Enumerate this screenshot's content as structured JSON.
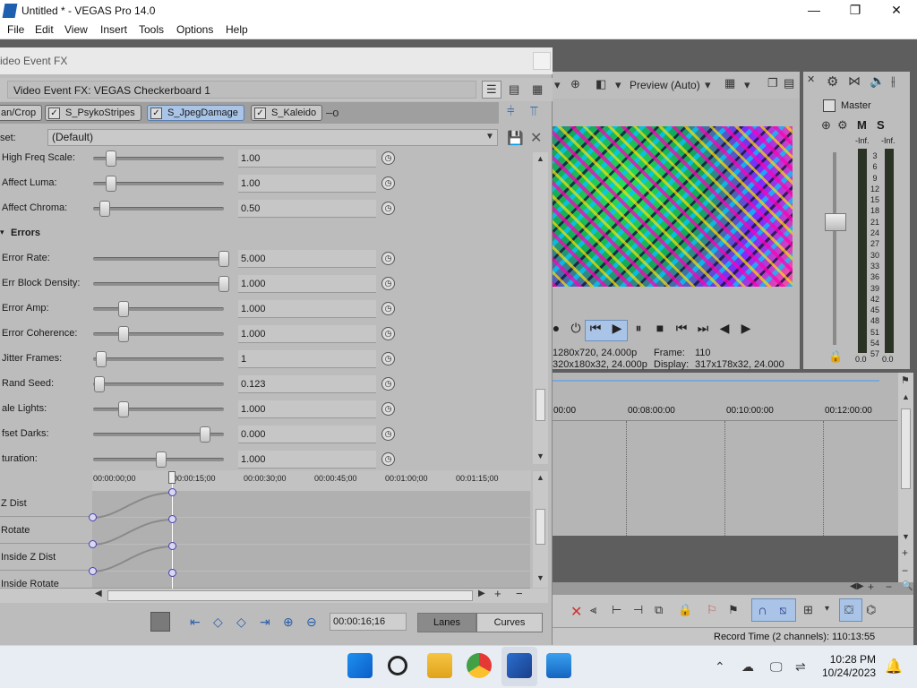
{
  "window": {
    "title": "Untitled * - VEGAS Pro 14.0",
    "minimize": "—",
    "maximize": "❐",
    "close": "✕"
  },
  "menu": [
    "File",
    "Edit",
    "View",
    "Insert",
    "Tools",
    "Options",
    "Help"
  ],
  "fx_dialog": {
    "title": "ideo Event FX",
    "header": "Video Event FX:  VEGAS Checkerboard 1",
    "chain": [
      {
        "label": "an/Crop",
        "selected": false
      },
      {
        "label": "S_PsykoStripes",
        "selected": false
      },
      {
        "label": "S_JpegDamage",
        "selected": true
      },
      {
        "label": "S_Kaleido",
        "selected": false
      }
    ],
    "preset_label": "set:",
    "preset_value": "(Default)",
    "params": [
      {
        "label": "High Freq Scale:",
        "value": "1.00",
        "knob": 0.1
      },
      {
        "label": "Affect Luma:",
        "value": "1.00",
        "knob": 0.1
      },
      {
        "label": "Affect Chroma:",
        "value": "0.50",
        "knob": 0.05
      },
      {
        "label": "Errors",
        "group": true
      },
      {
        "label": "Error Rate:",
        "value": "5.000",
        "knob": 1.0
      },
      {
        "label": "Err Block Density:",
        "value": "1.000",
        "knob": 1.0
      },
      {
        "label": "Error Amp:",
        "value": "1.000",
        "knob": 0.2
      },
      {
        "label": "Error Coherence:",
        "value": "1.000",
        "knob": 0.2
      },
      {
        "label": "Jitter Frames:",
        "value": "1",
        "knob": 0.02
      },
      {
        "label": "Rand Seed:",
        "value": "0.123",
        "knob": 0.01
      },
      {
        "label": "ale Lights:",
        "value": "1.000",
        "knob": 0.2
      },
      {
        "label": "fset Darks:",
        "value": "0.000",
        "knob": 0.85
      },
      {
        "label": "turation:",
        "value": "1.000",
        "knob": 0.5
      }
    ],
    "kf_ruler": [
      "00:00:00;00",
      "00:00:15;00",
      "00:00:30;00",
      "00:00:45;00",
      "00:01:00;00",
      "00:01:15;00"
    ],
    "kf_rows": [
      "Z Dist",
      "Rotate",
      "Inside Z Dist",
      "Inside Rotate"
    ],
    "time": "00:00:16;16",
    "lanes_label": "Lanes",
    "curves_label": "Curves"
  },
  "preview": {
    "quality": "Preview (Auto)",
    "project_line": "1280x720, 24.000p",
    "preview_line": "320x180x32, 24.000p",
    "frame_label": "Frame:",
    "frame_value": "110",
    "display_label": "Display:",
    "display_value": "317x178x32, 24.000"
  },
  "master": {
    "title": "Master",
    "m": "M",
    "s": "S",
    "inf_left": "-Inf.",
    "inf_right": "-Inf.",
    "scale": [
      "3",
      "6",
      "9",
      "12",
      "15",
      "18",
      "21",
      "24",
      "27",
      "30",
      "33",
      "36",
      "39",
      "42",
      "45",
      "48",
      "51",
      "54",
      "57"
    ],
    "bottom_left": "0.0",
    "bottom_right": "0.0"
  },
  "timeline": {
    "ruler": [
      "00:00",
      "00:08:00:00",
      "00:10:00:00",
      "00:12:00:00"
    ]
  },
  "status": {
    "record_time": "Record Time (2 channels): 110:13:55"
  },
  "taskbar": {
    "time": "10:28 PM",
    "date": "10/24/2023"
  }
}
